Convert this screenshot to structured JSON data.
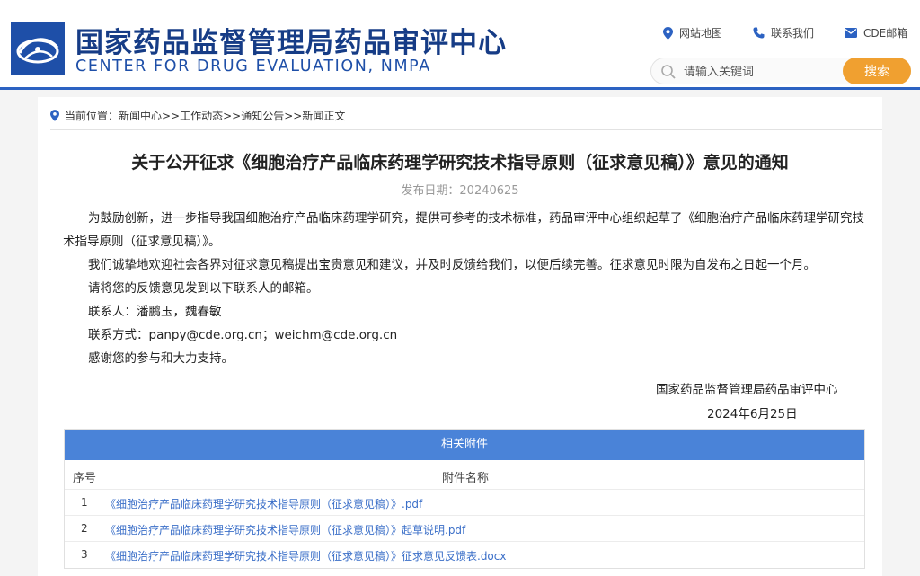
{
  "header": {
    "title_cn": "国家药品监督管理局药品审评中心",
    "title_en": "CENTER FOR DRUG EVALUATION, NMPA",
    "links": [
      {
        "label": "网站地图",
        "icon": "location-pin-icon"
      },
      {
        "label": "联系我们",
        "icon": "phone-icon"
      },
      {
        "label": "CDE邮箱",
        "icon": "mail-icon"
      }
    ],
    "search": {
      "placeholder": "请输入关键词",
      "button_label": "搜索"
    }
  },
  "colors": {
    "brand": "#1e4fa8",
    "accent": "#f0a030",
    "table_header": "#4a83d8",
    "link": "#3b6fc8"
  },
  "breadcrumb": "当前位置：新闻中心>>工作动态>>通知公告>>新闻正文",
  "article": {
    "title": "关于公开征求《细胞治疗产品临床药理学研究技术指导原则（征求意见稿）》意见的通知",
    "date": "发布日期：20240625",
    "paragraphs": [
      "为鼓励创新，进一步指导我国细胞治疗产品临床药理学研究，提供可参考的技术标准，药品审评中心组织起草了《细胞治疗产品临床药理学研究技术指导原则（征求意见稿）》。",
      "我们诚挚地欢迎社会各界对征求意见稿提出宝贵意见和建议，并及时反馈给我们，以便后续完善。征求意见时限为自发布之日起一个月。",
      "请将您的反馈意见发到以下联系人的邮箱。",
      "联系人：潘鹏玉，魏春敏",
      "联系方式：panpy@cde.org.cn；weichm@cde.org.cn",
      "感谢您的参与和大力支持。"
    ],
    "signature": "国家药品监督管理局药品审评中心",
    "sign_date": "2024年6月25日"
  },
  "attachments": {
    "heading": "相关附件",
    "col_num": "序号",
    "col_name": "附件名称",
    "rows": [
      {
        "num": "1",
        "name": "《细胞治疗产品临床药理学研究技术指导原则（征求意见稿）》.pdf"
      },
      {
        "num": "2",
        "name": "《细胞治疗产品临床药理学研究技术指导原则（征求意见稿）》起草说明.pdf"
      },
      {
        "num": "3",
        "name": "《细胞治疗产品临床药理学研究技术指导原则（征求意见稿）》征求意见反馈表.docx"
      }
    ]
  }
}
